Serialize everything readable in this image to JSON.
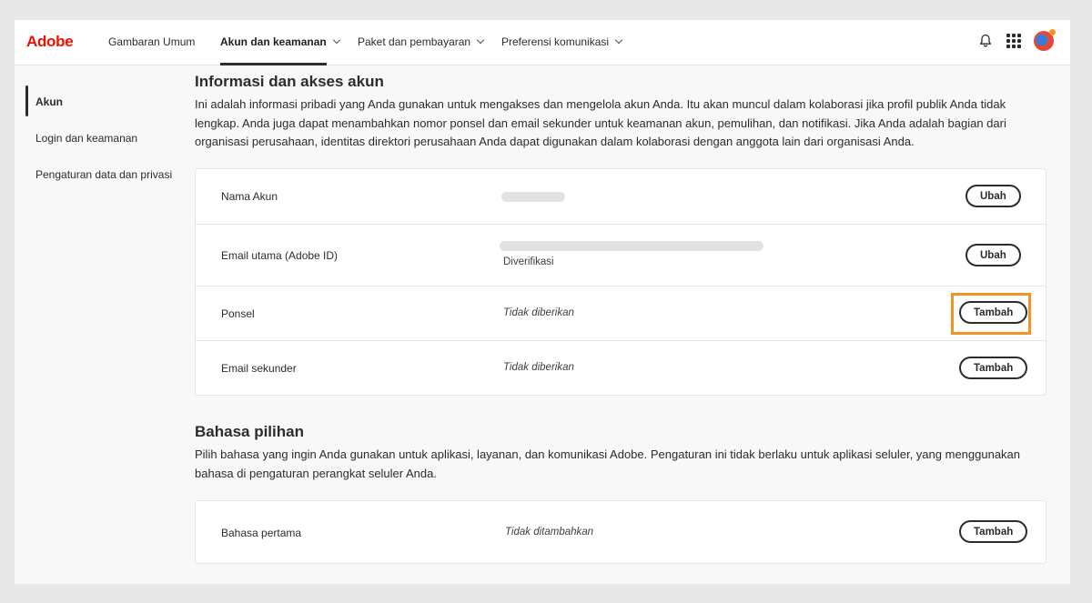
{
  "brand": {
    "name": "Adobe",
    "color": "#eb1000"
  },
  "nav": {
    "items": [
      {
        "label": "Gambaran Umum",
        "dropdown": false,
        "active": false
      },
      {
        "label": "Akun dan keamanan",
        "dropdown": true,
        "active": true
      },
      {
        "label": "Paket dan pembayaran",
        "dropdown": true,
        "active": false
      },
      {
        "label": "Preferensi komunikasi",
        "dropdown": true,
        "active": false
      }
    ],
    "icons": [
      "bell-icon",
      "apps-grid-icon",
      "avatar"
    ]
  },
  "sidebar": {
    "items": [
      {
        "label": "Akun",
        "active": true
      },
      {
        "label": "Login dan keamanan",
        "active": false
      },
      {
        "label": "Pengaturan data dan privasi",
        "active": false
      }
    ]
  },
  "account_section": {
    "title": "Informasi dan akses akun",
    "description": "Ini adalah informasi pribadi yang Anda gunakan untuk mengakses dan mengelola akun Anda. Itu akan muncul dalam kolaborasi jika profil publik Anda tidak lengkap. Anda juga dapat menambahkan nomor ponsel dan email sekunder untuk keamanan akun, pemulihan, dan notifikasi. Jika Anda adalah bagian dari organisasi perusahaan, identitas direktori perusahaan Anda dapat digunakan dalam kolaborasi dengan anggota lain dari organisasi Anda.",
    "rows": [
      {
        "label": "Nama Akun",
        "value": "",
        "button": "Ubah"
      },
      {
        "label": "Email utama (Adobe ID)",
        "value": "Diverifikasi",
        "button": "Ubah"
      },
      {
        "label": "Ponsel",
        "value": "Tidak diberikan",
        "button": "Tambah"
      },
      {
        "label": "Email sekunder",
        "value": "Tidak diberikan",
        "button": "Tambah"
      }
    ]
  },
  "language_section": {
    "title": "Bahasa pilihan",
    "description": "Pilih bahasa yang ingin Anda gunakan untuk aplikasi, layanan, dan komunikasi Adobe. Pengaturan ini tidak berlaku untuk aplikasi seluler, yang menggunakan bahasa di pengaturan perangkat seluler Anda.",
    "rows": [
      {
        "label": "Bahasa pertama",
        "value": "Tidak ditambahkan",
        "button": "Tambah"
      }
    ]
  },
  "colors": {
    "highlight": "#f29423",
    "text": "#2c2c2c"
  }
}
